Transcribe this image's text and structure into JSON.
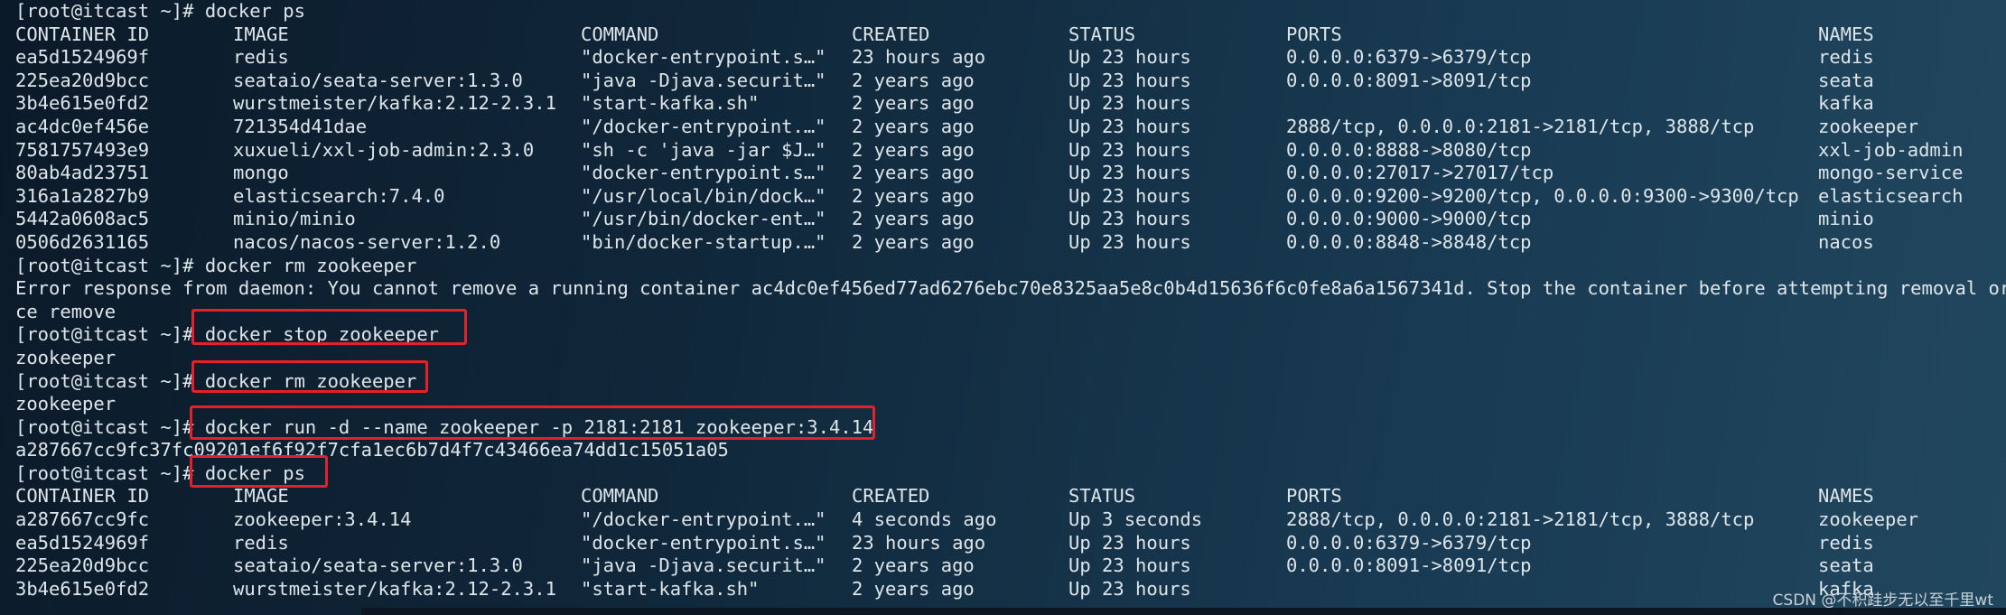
{
  "first_prompt": {
    "prompt": "[root@itcast ~]# ",
    "command": "docker ps"
  },
  "headers": {
    "container_id": "CONTAINER ID",
    "image": "IMAGE",
    "command": "COMMAND",
    "created": "CREATED",
    "status": "STATUS",
    "ports": "PORTS",
    "names": "NAMES"
  },
  "table1": [
    {
      "id": "ea5d1524969f",
      "image": "redis",
      "command": "\"docker-entrypoint.s…\"",
      "created": "23 hours ago",
      "status": "Up 23 hours",
      "ports": "0.0.0.0:6379->6379/tcp",
      "names": "redis"
    },
    {
      "id": "225ea20d9bcc",
      "image": "seataio/seata-server:1.3.0",
      "command": "\"java -Djava.securit…\"",
      "created": "2 years ago",
      "status": "Up 23 hours",
      "ports": "0.0.0.0:8091->8091/tcp",
      "names": "seata"
    },
    {
      "id": "3b4e615e0fd2",
      "image": "wurstmeister/kafka:2.12-2.3.1",
      "command": "\"start-kafka.sh\"",
      "created": "2 years ago",
      "status": "Up 23 hours",
      "ports": "",
      "names": "kafka"
    },
    {
      "id": "ac4dc0ef456e",
      "image": "721354d41dae",
      "command": "\"/docker-entrypoint.…\"",
      "created": "2 years ago",
      "status": "Up 23 hours",
      "ports": "2888/tcp, 0.0.0.0:2181->2181/tcp, 3888/tcp",
      "names": "zookeeper"
    },
    {
      "id": "7581757493e9",
      "image": "xuxueli/xxl-job-admin:2.3.0",
      "command": "\"sh -c 'java -jar $J…\"",
      "created": "2 years ago",
      "status": "Up 23 hours",
      "ports": "0.0.0.0:8888->8080/tcp",
      "names": "xxl-job-admin"
    },
    {
      "id": "80ab4ad23751",
      "image": "mongo",
      "command": "\"docker-entrypoint.s…\"",
      "created": "2 years ago",
      "status": "Up 23 hours",
      "ports": "0.0.0.0:27017->27017/tcp",
      "names": "mongo-service"
    },
    {
      "id": "316a1a2827b9",
      "image": "elasticsearch:7.4.0",
      "command": "\"/usr/local/bin/dock…\"",
      "created": "2 years ago",
      "status": "Up 23 hours",
      "ports": "0.0.0.0:9200->9200/tcp, 0.0.0.0:9300->9300/tcp",
      "names": "elasticsearch"
    },
    {
      "id": "5442a0608ac5",
      "image": "minio/minio",
      "command": "\"/usr/bin/docker-ent…\"",
      "created": "2 years ago",
      "status": "Up 23 hours",
      "ports": "0.0.0.0:9000->9000/tcp",
      "names": "minio"
    },
    {
      "id": "0506d2631165",
      "image": "nacos/nacos-server:1.2.0",
      "command": "\"bin/docker-startup.…\"",
      "created": "2 years ago",
      "status": "Up 23 hours",
      "ports": "0.0.0.0:8848->8848/tcp",
      "names": "nacos"
    }
  ],
  "rm_attempt": {
    "prompt": "[root@itcast ~]# ",
    "command": "docker rm zookeeper"
  },
  "error_line1": "Error response from daemon: You cannot remove a running container ac4dc0ef456ed77ad6276ebc70e8325aa5e8c0b4d15636f6c0fe8a6a1567341d. Stop the container before attempting removal or for",
  "error_line2": "ce remove",
  "stop_cmd": {
    "prompt": "[root@itcast ~]# ",
    "command": "docker stop zookeeper",
    "output": "zookeeper"
  },
  "rm_cmd": {
    "prompt": "[root@itcast ~]# ",
    "command": "docker rm zookeeper",
    "output": "zookeeper"
  },
  "run_cmd": {
    "prompt": "[root@itcast ~]# ",
    "command": "docker run -d --name zookeeper -p 2181:2181 zookeeper:3.4.14",
    "output": "a287667cc9fc37fc09201ef6f92f7cfa1ec6b7d4f7c43466ea74dd1c15051a05"
  },
  "ps_cmd": {
    "prompt": "[root@itcast ~]# ",
    "command": "docker ps"
  },
  "table2": [
    {
      "id": "a287667cc9fc",
      "image": "zookeeper:3.4.14",
      "command": "\"/docker-entrypoint.…\"",
      "created": "4 seconds ago",
      "status": "Up 3 seconds",
      "ports": "2888/tcp, 0.0.0.0:2181->2181/tcp, 3888/tcp",
      "names": "zookeeper"
    },
    {
      "id": "ea5d1524969f",
      "image": "redis",
      "command": "\"docker-entrypoint.s…\"",
      "created": "23 hours ago",
      "status": "Up 23 hours",
      "ports": "0.0.0.0:6379->6379/tcp",
      "names": "redis"
    },
    {
      "id": "225ea20d9bcc",
      "image": "seataio/seata-server:1.3.0",
      "command": "\"java -Djava.securit…\"",
      "created": "2 years ago",
      "status": "Up 23 hours",
      "ports": "0.0.0.0:8091->8091/tcp",
      "names": "seata"
    },
    {
      "id": "3b4e615e0fd2",
      "image": "wurstmeister/kafka:2.12-2.3.1",
      "command": "\"start-kafka.sh\"",
      "created": "2 years ago",
      "status": "Up 23 hours",
      "ports": "",
      "names": "kafka"
    }
  ],
  "watermark": "CSDN @不积跬步无以至千里wt",
  "colors": {
    "highlight": "#e5202a",
    "text": "#dfe6ea"
  }
}
